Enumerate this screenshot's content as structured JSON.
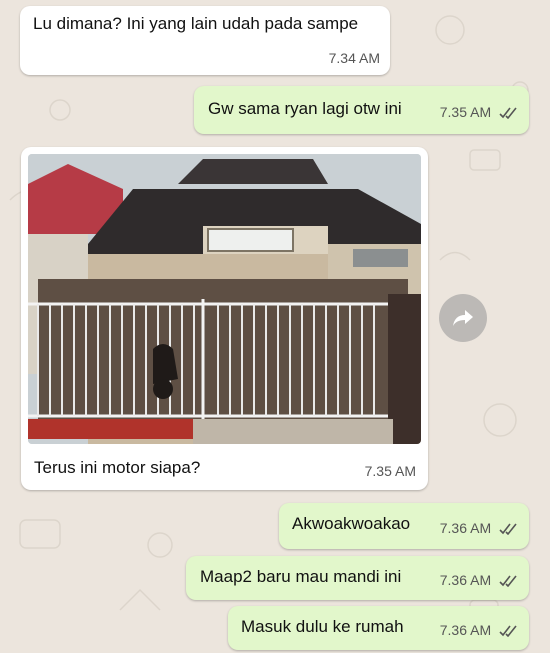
{
  "chat": {
    "messages": [
      {
        "direction": "incoming",
        "text": "Lu dimana? Ini yang lain udah pada sampe",
        "time": "7.34 AM"
      },
      {
        "direction": "outgoing",
        "text": "Gw sama ryan lagi otw ini",
        "time": "7.35 AM",
        "status": "read"
      },
      {
        "direction": "incoming",
        "type": "image",
        "image_icon": "house-photo",
        "caption": "Terus ini motor siapa?",
        "time": "7.35 AM"
      },
      {
        "direction": "outgoing",
        "text": "Akwoakwoakao",
        "time": "7.36 AM",
        "status": "read"
      },
      {
        "direction": "outgoing",
        "text": "Maap2 baru mau mandi ini",
        "time": "7.36 AM",
        "status": "read"
      },
      {
        "direction": "outgoing",
        "text": "Masuk dulu ke rumah",
        "time": "7.36 AM",
        "status": "read"
      }
    ]
  },
  "icons": {
    "forward": "forward-arrow-icon",
    "read_receipt": "double-check-icon"
  },
  "colors": {
    "incoming": "#ffffff",
    "outgoing": "#e2f7cb",
    "background": "#ece5dd",
    "ticks": "#555555"
  }
}
